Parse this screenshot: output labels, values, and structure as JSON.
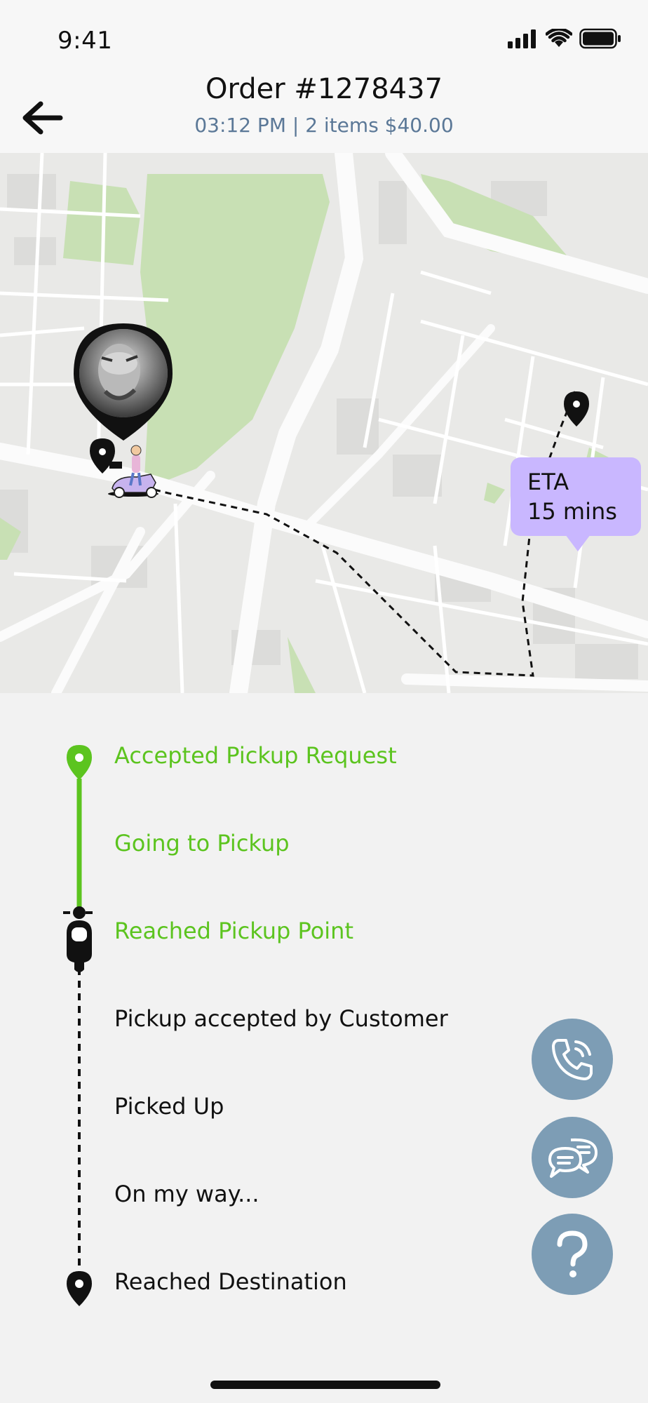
{
  "status_bar": {
    "time": "9:41"
  },
  "header": {
    "title": "Order #1278437",
    "subtitle": "03:12 PM | 2 items $40.00"
  },
  "map": {
    "eta_label": "ETA",
    "eta_value": "15 mins"
  },
  "timeline": {
    "steps": [
      {
        "label": "Accepted Pickup Request",
        "done": true
      },
      {
        "label": "Going to Pickup",
        "done": true
      },
      {
        "label": "Reached Pickup Point",
        "done": true
      },
      {
        "label": "Pickup accepted by Customer",
        "done": false
      },
      {
        "label": "Picked Up",
        "done": false
      },
      {
        "label": "On my way...",
        "done": false
      },
      {
        "label": "Reached Destination",
        "done": false
      }
    ]
  },
  "actions": {
    "call_icon": "phone-icon",
    "chat_icon": "chat-icon",
    "help_icon": "help-icon"
  },
  "colors": {
    "done": "#5cc41f",
    "accent": "#7d9db5",
    "eta_bg": "#c9b7ff",
    "park": "#c8e0b4"
  }
}
